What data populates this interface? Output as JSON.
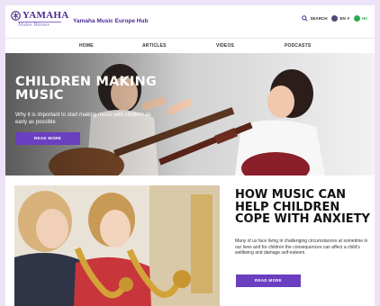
{
  "brand": {
    "logo_text": "YAMAHA",
    "logo_tagline": "Make Waves",
    "hub_title": "Yamaha Music Europe Hub"
  },
  "header_tools": {
    "search_label": "SEARCH",
    "language_label": "EN",
    "user_label": "HI!",
    "search_icon": "search-icon",
    "globe_icon": "globe-icon",
    "user_icon": "user-icon"
  },
  "nav": {
    "items": [
      {
        "label": "HOME"
      },
      {
        "label": "ARTICLES"
      },
      {
        "label": "VIDEOS"
      },
      {
        "label": "PODCASTS"
      }
    ]
  },
  "hero": {
    "title": "CHILDREN MAKING MUSIC",
    "description": "Why it is important to start making music with children as early as possible",
    "button_label": "READ MORE"
  },
  "featured": {
    "title": "HOW MUSIC CAN HELP CHILDREN COPE WITH ANXIETY",
    "description": "Many of us face living in challenging circumstances at sometime in our lives and for children the consequences can affect a child's wellbeing and damage self-esteem.",
    "button_label": "READ MORE"
  },
  "colors": {
    "accent": "#6a3fc0",
    "brand": "#4b2a8f",
    "background": "#ece4f6",
    "user_badge": "#2eaa4d"
  }
}
